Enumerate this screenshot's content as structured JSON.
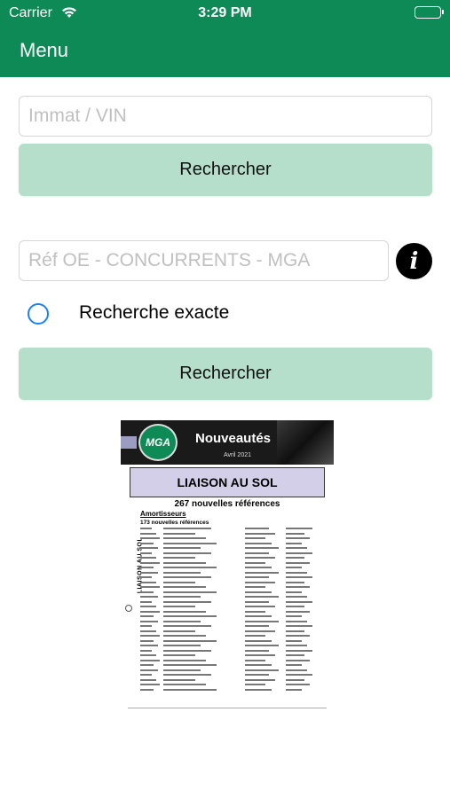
{
  "status_bar": {
    "carrier": "Carrier",
    "time": "3:29 PM"
  },
  "nav": {
    "menu_label": "Menu"
  },
  "search_vin": {
    "placeholder": "Immat / VIN",
    "button_label": "Rechercher"
  },
  "search_ref": {
    "placeholder": "Réf OE - CONCURRENTS - MGA",
    "exact_label": "Recherche exacte",
    "button_label": "Rechercher"
  },
  "document": {
    "logo": "MGA",
    "banner_title": "Nouveautés",
    "banner_date": "Avril 2021",
    "section": "LIAISON AU SOL",
    "subtitle": "267 nouvelles références",
    "category": "Amortisseurs",
    "category_count": "173 nouvelles références",
    "side_label": "LIAISON AU SOL"
  },
  "colors": {
    "brand_green": "#0e8a56",
    "button_bg": "#b5dfcb",
    "radio_blue": "#1a82f0"
  }
}
